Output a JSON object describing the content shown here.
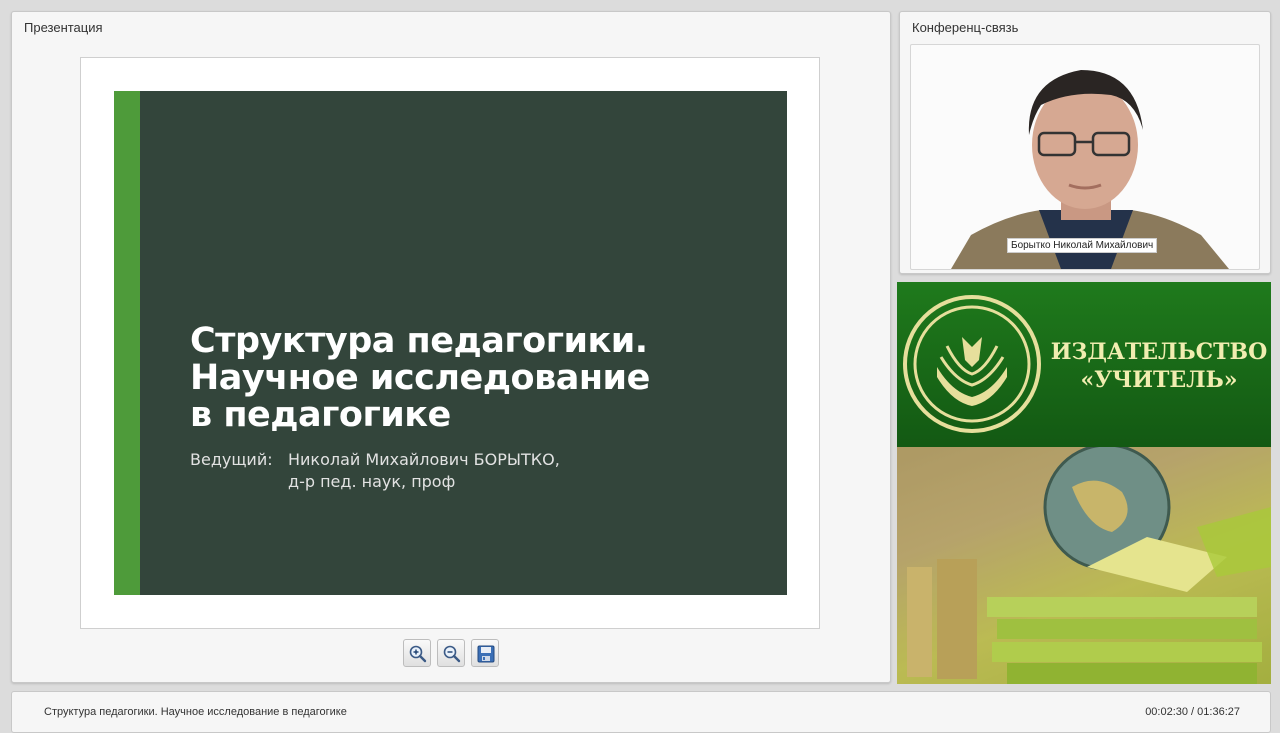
{
  "presentation_panel": {
    "title": "Презентация",
    "slide": {
      "title_lines": [
        "Структура педагогики.",
        "Научное исследование",
        "в педагогике"
      ],
      "presenter_label": "Ведущий:",
      "presenter_name": "Николай Михайлович БОРЫТКО,",
      "presenter_credentials": "д-р пед. наук, проф",
      "accent_color": "#4e9b3a",
      "background_color": "#33453b"
    },
    "toolbar": {
      "zoom_in_icon": "zoom-in-icon",
      "zoom_out_icon": "zoom-out-icon",
      "save_icon": "save-icon"
    }
  },
  "conference_panel": {
    "title": "Конференц-связь",
    "participant_name": "Борытко Николай Михайлович"
  },
  "publisher": {
    "name_line1": "ИЗДАТЕЛЬСТВО",
    "name_line2": "«УЧИТЕЛЬ»",
    "logo_icon": "book-tulip-logo-icon",
    "brand_color": "#1f7a1c"
  },
  "status_bar": {
    "title": "Структура педагогики. Научное исследование в педагогике",
    "time": "00:02:30 / 01:36:27"
  }
}
